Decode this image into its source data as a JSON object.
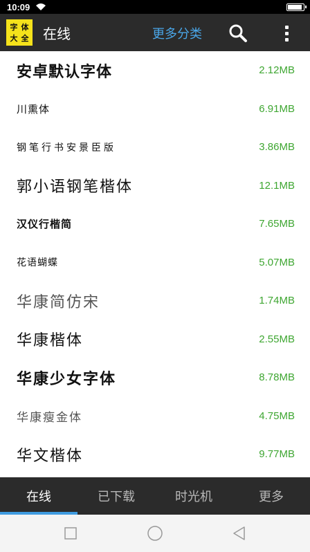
{
  "status_bar": {
    "time": "10:09",
    "battery_level": 0.85
  },
  "app_bar": {
    "logo_chars": [
      "字",
      "体",
      "大",
      "全"
    ],
    "title": "在线",
    "more_categories": "更多分类",
    "search_icon": "search-icon",
    "menu_icon": "more-vert-icon"
  },
  "fonts": [
    {
      "name": "安卓默认字体",
      "size": "2.12MB"
    },
    {
      "name": "川熏体",
      "size": "6.91MB"
    },
    {
      "name": "钢笔行书安景臣版",
      "size": "3.86MB"
    },
    {
      "name": "郭小语钢笔楷体",
      "size": "12.1MB"
    },
    {
      "name": "汉仪行楷简",
      "size": "7.65MB"
    },
    {
      "name": "花语蝴蝶",
      "size": "5.07MB"
    },
    {
      "name": "华康简仿宋",
      "size": "1.74MB"
    },
    {
      "name": "华康楷体",
      "size": "2.55MB"
    },
    {
      "name": "华康少女字体",
      "size": "8.78MB"
    },
    {
      "name": "华康瘦金体",
      "size": "4.75MB"
    },
    {
      "name": "华文楷体",
      "size": "9.77MB"
    }
  ],
  "tabs": [
    {
      "label": "在线",
      "active": true
    },
    {
      "label": "已下载",
      "active": false
    },
    {
      "label": "时光机",
      "active": false
    },
    {
      "label": "更多",
      "active": false
    }
  ],
  "colors": {
    "accent": "#3f9be0",
    "size_text": "#3ea631",
    "bar_bg": "#2b2b2b",
    "logo_bg": "#f5e21b"
  }
}
